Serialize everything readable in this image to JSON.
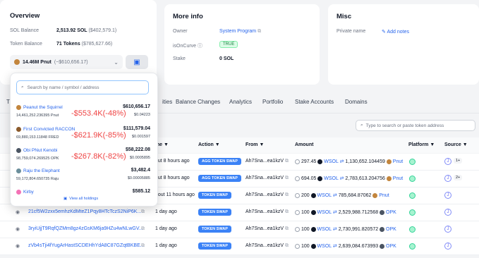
{
  "overview": {
    "title": "Overview",
    "sol_balance_label": "SOL Balance",
    "sol_balance": "2,513.92 SOL",
    "sol_balance_usd": "($402,579.1)",
    "token_balance_label": "Token Balance",
    "token_balance": "71 Tokens",
    "token_balance_usd": "($785,627.66)",
    "selected_token": "14.46M Pnut",
    "selected_token_usd": "(~$610,656.17)"
  },
  "more_info": {
    "title": "More info",
    "owner_label": "Owner",
    "owner_value": "System Program",
    "isoncurve_label": "isOnCurve",
    "isoncurve_value": "TRUE",
    "stake_label": "Stake",
    "stake_value": "0 SOL"
  },
  "misc": {
    "title": "Misc",
    "private_name_label": "Private name",
    "add_notes": "Add notes"
  },
  "tabs": {
    "t0": "T",
    "t1": "ities",
    "t2": "Balance Changes",
    "t3": "Analytics",
    "t4": "Portfolio",
    "t5": "Stake Accounts",
    "t6": "Domains"
  },
  "table_search_placeholder": "Type to search or paste token address",
  "columns": {
    "time": "ime",
    "action": "Action",
    "from": "From",
    "amount": "Amount",
    "platform": "Platform",
    "source": "Source"
  },
  "dropdown": {
    "search_placeholder": "Search by name / symbol / address",
    "items": [
      {
        "name": "Peanut the Squirrel",
        "amount": "14,461,252.236395 Pnut",
        "usd": "$610,656.17",
        "price": "$0.04223",
        "loss": "-$553.4K(-48%)"
      },
      {
        "name": "First Convicted RACCON",
        "amount": "69,880,153.11848 FRED",
        "usd": "$111,579.04",
        "price": "$0.001597",
        "loss": "-$621.9K(-85%)"
      },
      {
        "name": "Obi PNut Kenobi",
        "amount": "98,759,074.269525 OPK",
        "usd": "$58,222.08",
        "price": "$0.0005895",
        "loss": "-$267.8K(-82%)"
      },
      {
        "name": "Raju the Elephant",
        "amount": "59,172,804.650735 Raju",
        "usd": "$3,482.4",
        "price": "$0.00005885",
        "loss": ""
      },
      {
        "name": "Kirby",
        "amount": "",
        "usd": "$585.12",
        "price": "",
        "loss": ""
      }
    ],
    "view_all": "View all holdings"
  },
  "rows": [
    {
      "sig": "",
      "time": "out 8 hours ago",
      "action": "AGG TOKEN SWAP",
      "from": "Ah7Sna...ea1kzV",
      "amt_in": "297.45",
      "tok_in": "WSOL",
      "amt_out": "1,130,652.104459",
      "tok_out": "Pnut",
      "src_count": "1+"
    },
    {
      "sig": "",
      "time": "out 8 hours ago",
      "action": "AGG TOKEN SWAP",
      "from": "Ah7Sna...ea1kzV",
      "amt_in": "694.05",
      "tok_in": "WSOL",
      "amt_out": "2,783,613.204756",
      "tok_out": "Pnut",
      "src_count": "2+"
    },
    {
      "sig": "",
      "time": "bout 11 hours ago",
      "action": "TOKEN SWAP",
      "from": "Ah7Sna...ea1kzV",
      "amt_in": "200",
      "tok_in": "WSOL",
      "amt_out": "785,684.87062",
      "tok_out": "Pnut",
      "src_count": ""
    },
    {
      "sig": "21cf5W2zxx5emhzKdMteZ1Pqy8HTcTczS2NiP6K...",
      "time": "1 day ago",
      "action": "TOKEN SWAP",
      "from": "Ah7Sna...ea1kzV",
      "amt_in": "100",
      "tok_in": "WSOL",
      "amt_out": "2,529,988.712568",
      "tok_out": "OPK",
      "src_count": ""
    },
    {
      "sig": "3ryiUjjT9RqfQZMm8gz4zGsKM6ja9HZu4wNLwGV...",
      "time": "1 day ago",
      "action": "TOKEN SWAP",
      "from": "Ah7Sna...ea1kzV",
      "amt_in": "100",
      "tok_in": "WSOL",
      "amt_out": "2,730,991.820572",
      "tok_out": "OPK",
      "src_count": ""
    },
    {
      "sig": "zVb4sTji4fYugArHastSCDEHhYdA8C87GZqtBKBE...",
      "time": "1 day ago",
      "action": "TOKEN SWAP",
      "from": "Ah7Sna...ea1kzV",
      "amt_in": "100",
      "tok_in": "WSOL",
      "amt_out": "2,639,084.673993",
      "tok_out": "OPK",
      "src_count": ""
    }
  ]
}
